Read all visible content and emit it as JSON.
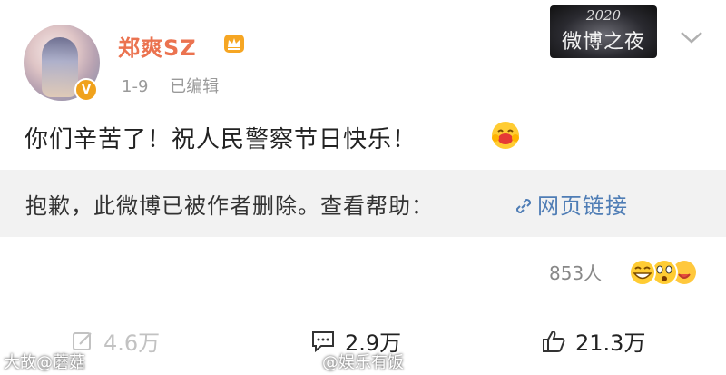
{
  "post": {
    "username": "郑爽SZ",
    "date": "1-9",
    "edited_label": "已编辑",
    "content": "你们辛苦了！祝人民警察节日快乐！",
    "event_badge": {
      "year": "2020",
      "name": "微博之夜"
    }
  },
  "deleted_notice": {
    "text": "抱歉，此微博已被作者删除。查看帮助：",
    "link_label": "网页链接"
  },
  "reactions": {
    "count_label": "853人"
  },
  "actions": {
    "repost": "4.6万",
    "comment": "2.9万",
    "like": "21.3万"
  },
  "watermarks": {
    "left": "大故@蘑菇",
    "right": "@娱乐有饭"
  },
  "colors": {
    "username": "#eb7350",
    "link": "#4f7db5",
    "deleted_bg": "#f2f2f2",
    "badge_v": "#f0a21c"
  },
  "icons": [
    "vip-crown-icon",
    "verified-v-icon",
    "chevron-down-icon",
    "hug-emoji-icon",
    "link-icon",
    "reaction-emojis-icon",
    "repost-icon",
    "comment-icon",
    "like-icon"
  ]
}
